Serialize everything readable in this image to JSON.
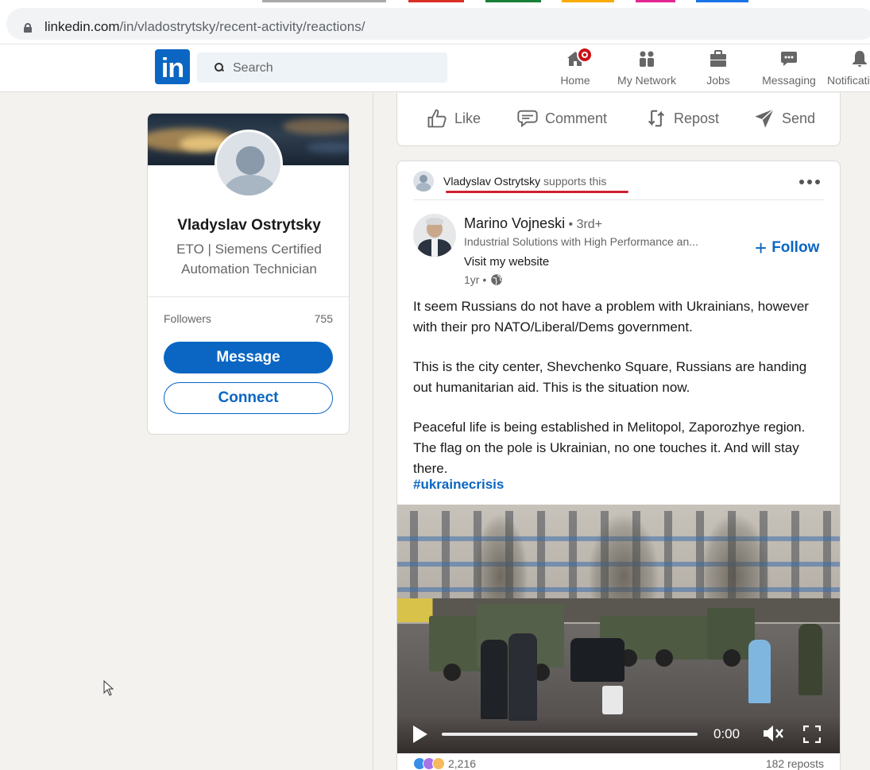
{
  "browser": {
    "url_host": "linkedin.com",
    "url_path": "/in/vladostrytsky/recent-activity/reactions/",
    "tab_colors": [
      "#a9a9a9",
      "#d93025",
      "#188038",
      "#f9ab00",
      "#e52592",
      "#1a73e8"
    ]
  },
  "nav": {
    "logo": "in",
    "search_placeholder": "Search",
    "items": [
      {
        "label": "Home",
        "icon": "home-icon"
      },
      {
        "label": "My Network",
        "icon": "network-icon"
      },
      {
        "label": "Jobs",
        "icon": "briefcase-icon"
      },
      {
        "label": "Messaging",
        "icon": "chat-icon"
      },
      {
        "label": "Notifications",
        "icon": "bell-icon"
      }
    ],
    "home_badge_color": "#cc1016"
  },
  "profile": {
    "name": "Vladyslav Ostrytsky",
    "headline": "ETO | Siemens Certified Automation Technician",
    "followers_label": "Followers",
    "followers_count": "755",
    "message_label": "Message",
    "connect_label": "Connect"
  },
  "prev_post_actions": [
    {
      "label": "Like",
      "icon": "thumbs-up-icon"
    },
    {
      "label": "Comment",
      "icon": "comment-icon"
    },
    {
      "label": "Repost",
      "icon": "repost-icon"
    },
    {
      "label": "Send",
      "icon": "send-icon"
    }
  ],
  "post": {
    "context_name": "Vladyslav Ostrytsky",
    "context_suffix": " supports this",
    "author_name": "Marino Vojneski",
    "author_degree": " • 3rd+",
    "author_headline": "Industrial Solutions with High Performance an...",
    "visit_website": "Visit my website",
    "age": "1yr •",
    "follow_label": "Follow",
    "paragraphs": [
      "It seem Russians do not have a problem with Ukrainians, however with their pro NATO/Liberal/Dems government.",
      "This is the city center, Shevchenko Square, Russians are handing out humanitarian aid. This is the situation now.",
      "Peaceful life is being established in Melitopol, Zaporozhye region. The flag on the pole is Ukrainian, no one touches it. And will stay there."
    ],
    "hashtag": "#ukrainecrisis",
    "video": {
      "time": "0:00",
      "progress": 0
    },
    "reaction_count": "2,216",
    "reposts": "182 reposts"
  },
  "colors": {
    "linkedin_blue": "#0a66c2",
    "annotation_red": "#d0202f"
  }
}
